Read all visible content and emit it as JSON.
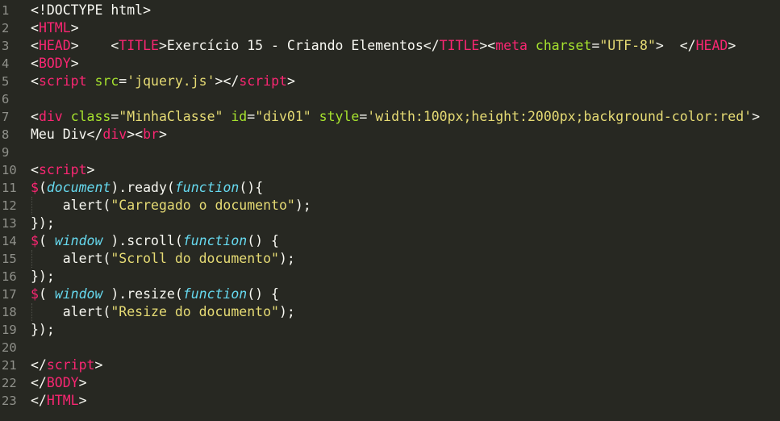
{
  "editor": {
    "colors": {
      "background": "#272822",
      "plain": "#f8f8f2",
      "tag": "#f92672",
      "attribute": "#a6e22e",
      "string": "#e6db74",
      "italic_keyword": "#66d9ef",
      "gutter_number": "#8f908a"
    },
    "lines": [
      {
        "n": "1",
        "tokens": [
          {
            "t": "<!DOCTYPE html>",
            "c": "plain"
          }
        ]
      },
      {
        "n": "2",
        "tokens": [
          {
            "t": "<",
            "c": "plain"
          },
          {
            "t": "HTML",
            "c": "tag"
          },
          {
            "t": ">",
            "c": "plain"
          }
        ]
      },
      {
        "n": "3",
        "tokens": [
          {
            "t": "<",
            "c": "plain"
          },
          {
            "t": "HEAD",
            "c": "tag"
          },
          {
            "t": ">    <",
            "c": "plain"
          },
          {
            "t": "TITLE",
            "c": "tag"
          },
          {
            "t": ">Exercício 15 - Criando Elementos</",
            "c": "plain"
          },
          {
            "t": "TITLE",
            "c": "tag"
          },
          {
            "t": "><",
            "c": "plain"
          },
          {
            "t": "meta",
            "c": "tag"
          },
          {
            "t": " ",
            "c": "plain"
          },
          {
            "t": "charset",
            "c": "attr"
          },
          {
            "t": "=",
            "c": "plain"
          },
          {
            "t": "\"UTF-8\"",
            "c": "str"
          },
          {
            "t": ">  </",
            "c": "plain"
          },
          {
            "t": "HEAD",
            "c": "tag"
          },
          {
            "t": ">",
            "c": "plain"
          }
        ]
      },
      {
        "n": "4",
        "tokens": [
          {
            "t": "<",
            "c": "plain"
          },
          {
            "t": "BODY",
            "c": "tag"
          },
          {
            "t": ">",
            "c": "plain"
          }
        ]
      },
      {
        "n": "5",
        "tokens": [
          {
            "t": "<",
            "c": "plain"
          },
          {
            "t": "script",
            "c": "tag"
          },
          {
            "t": " ",
            "c": "plain"
          },
          {
            "t": "src",
            "c": "attr"
          },
          {
            "t": "=",
            "c": "plain"
          },
          {
            "t": "'jquery.js'",
            "c": "str"
          },
          {
            "t": "></",
            "c": "plain"
          },
          {
            "t": "script",
            "c": "tag"
          },
          {
            "t": ">",
            "c": "plain"
          }
        ]
      },
      {
        "n": "6",
        "tokens": []
      },
      {
        "n": "7",
        "tokens": [
          {
            "t": "<",
            "c": "plain"
          },
          {
            "t": "div",
            "c": "tag"
          },
          {
            "t": " ",
            "c": "plain"
          },
          {
            "t": "class",
            "c": "attr"
          },
          {
            "t": "=",
            "c": "plain"
          },
          {
            "t": "\"MinhaClasse\"",
            "c": "str"
          },
          {
            "t": " ",
            "c": "plain"
          },
          {
            "t": "id",
            "c": "attr"
          },
          {
            "t": "=",
            "c": "plain"
          },
          {
            "t": "\"div01\"",
            "c": "str"
          },
          {
            "t": " ",
            "c": "plain"
          },
          {
            "t": "style",
            "c": "attr"
          },
          {
            "t": "=",
            "c": "plain"
          },
          {
            "t": "'width:100px;height:2000px;background-color:red'",
            "c": "str"
          },
          {
            "t": ">",
            "c": "plain"
          }
        ]
      },
      {
        "n": "8",
        "tokens": [
          {
            "t": "Meu Div</",
            "c": "plain"
          },
          {
            "t": "div",
            "c": "tag"
          },
          {
            "t": "><",
            "c": "plain"
          },
          {
            "t": "br",
            "c": "tag"
          },
          {
            "t": ">",
            "c": "plain"
          }
        ]
      },
      {
        "n": "9",
        "tokens": []
      },
      {
        "n": "10",
        "tokens": [
          {
            "t": "<",
            "c": "plain"
          },
          {
            "t": "script",
            "c": "tag"
          },
          {
            "t": ">",
            "c": "plain"
          }
        ]
      },
      {
        "n": "11",
        "tokens": [
          {
            "t": "$",
            "c": "tag"
          },
          {
            "t": "(",
            "c": "plain"
          },
          {
            "t": "document",
            "c": "ital"
          },
          {
            "t": ").ready(",
            "c": "plain"
          },
          {
            "t": "function",
            "c": "ital"
          },
          {
            "t": "(){",
            "c": "plain"
          }
        ]
      },
      {
        "n": "12",
        "guide": true,
        "tokens": [
          {
            "t": "    alert(",
            "c": "plain"
          },
          {
            "t": "\"Carregado o documento\"",
            "c": "str"
          },
          {
            "t": ");",
            "c": "plain"
          }
        ]
      },
      {
        "n": "13",
        "tokens": [
          {
            "t": "});",
            "c": "plain"
          }
        ]
      },
      {
        "n": "14",
        "tokens": [
          {
            "t": "$",
            "c": "tag"
          },
          {
            "t": "( ",
            "c": "plain"
          },
          {
            "t": "window",
            "c": "ital"
          },
          {
            "t": " ).scroll(",
            "c": "plain"
          },
          {
            "t": "function",
            "c": "ital"
          },
          {
            "t": "() {",
            "c": "plain"
          }
        ]
      },
      {
        "n": "15",
        "guide": true,
        "tokens": [
          {
            "t": "    alert(",
            "c": "plain"
          },
          {
            "t": "\"Scroll do documento\"",
            "c": "str"
          },
          {
            "t": ");",
            "c": "plain"
          }
        ]
      },
      {
        "n": "16",
        "tokens": [
          {
            "t": "});",
            "c": "plain"
          }
        ]
      },
      {
        "n": "17",
        "tokens": [
          {
            "t": "$",
            "c": "tag"
          },
          {
            "t": "( ",
            "c": "plain"
          },
          {
            "t": "window",
            "c": "ital"
          },
          {
            "t": " ).resize(",
            "c": "plain"
          },
          {
            "t": "function",
            "c": "ital"
          },
          {
            "t": "() {",
            "c": "plain"
          }
        ]
      },
      {
        "n": "18",
        "guide": true,
        "tokens": [
          {
            "t": "    alert(",
            "c": "plain"
          },
          {
            "t": "\"Resize do documento\"",
            "c": "str"
          },
          {
            "t": ");",
            "c": "plain"
          }
        ]
      },
      {
        "n": "19",
        "tokens": [
          {
            "t": "});",
            "c": "plain"
          }
        ]
      },
      {
        "n": "20",
        "tokens": []
      },
      {
        "n": "21",
        "tokens": [
          {
            "t": "</",
            "c": "plain"
          },
          {
            "t": "script",
            "c": "tag"
          },
          {
            "t": ">",
            "c": "plain"
          }
        ]
      },
      {
        "n": "22",
        "tokens": [
          {
            "t": "</",
            "c": "plain"
          },
          {
            "t": "BODY",
            "c": "tag"
          },
          {
            "t": ">",
            "c": "plain"
          }
        ]
      },
      {
        "n": "23",
        "tokens": [
          {
            "t": "</",
            "c": "plain"
          },
          {
            "t": "HTML",
            "c": "tag"
          },
          {
            "t": ">",
            "c": "plain"
          }
        ]
      }
    ]
  }
}
